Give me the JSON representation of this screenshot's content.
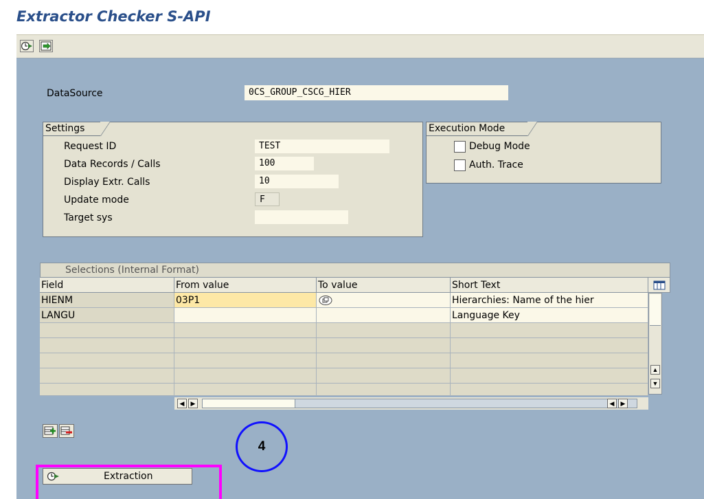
{
  "title": "Extractor Checker S-API",
  "toolbar": {
    "icons": [
      "execute-icon",
      "save-icon"
    ]
  },
  "datasource": {
    "label": "DataSource",
    "value": "0CS_GROUP_CSCG_HIER"
  },
  "settings": {
    "title": "Settings",
    "rows": [
      {
        "label": "Request ID",
        "value": "TEST"
      },
      {
        "label": "Data Records / Calls",
        "value": "100"
      },
      {
        "label": "Display Extr. Calls",
        "value": "10"
      },
      {
        "label": "Update mode",
        "value": "F"
      },
      {
        "label": "Target sys",
        "value": ""
      }
    ]
  },
  "execution": {
    "title": "Execution Mode",
    "options": [
      {
        "label": "Debug Mode",
        "checked": false
      },
      {
        "label": "Auth. Trace",
        "checked": false
      }
    ]
  },
  "selections": {
    "title": "Selections (Internal Format)",
    "columns": [
      "Field",
      "From value",
      "To value",
      "Short Text"
    ],
    "rows": [
      {
        "field": "HIENM",
        "from": "03P1",
        "to": "",
        "short": "Hierarchies: Name of the hier"
      },
      {
        "field": "LANGU",
        "from": "",
        "to": "",
        "short": "Language Key"
      }
    ]
  },
  "extraction_button": {
    "label": "Extraction"
  },
  "step_marker": {
    "label": "4"
  },
  "colors": {
    "title": "#2a4f8a",
    "content_bg": "#9ab0c6",
    "highlight_frame": "#ff00ff",
    "step_circle": "#1010ff"
  }
}
